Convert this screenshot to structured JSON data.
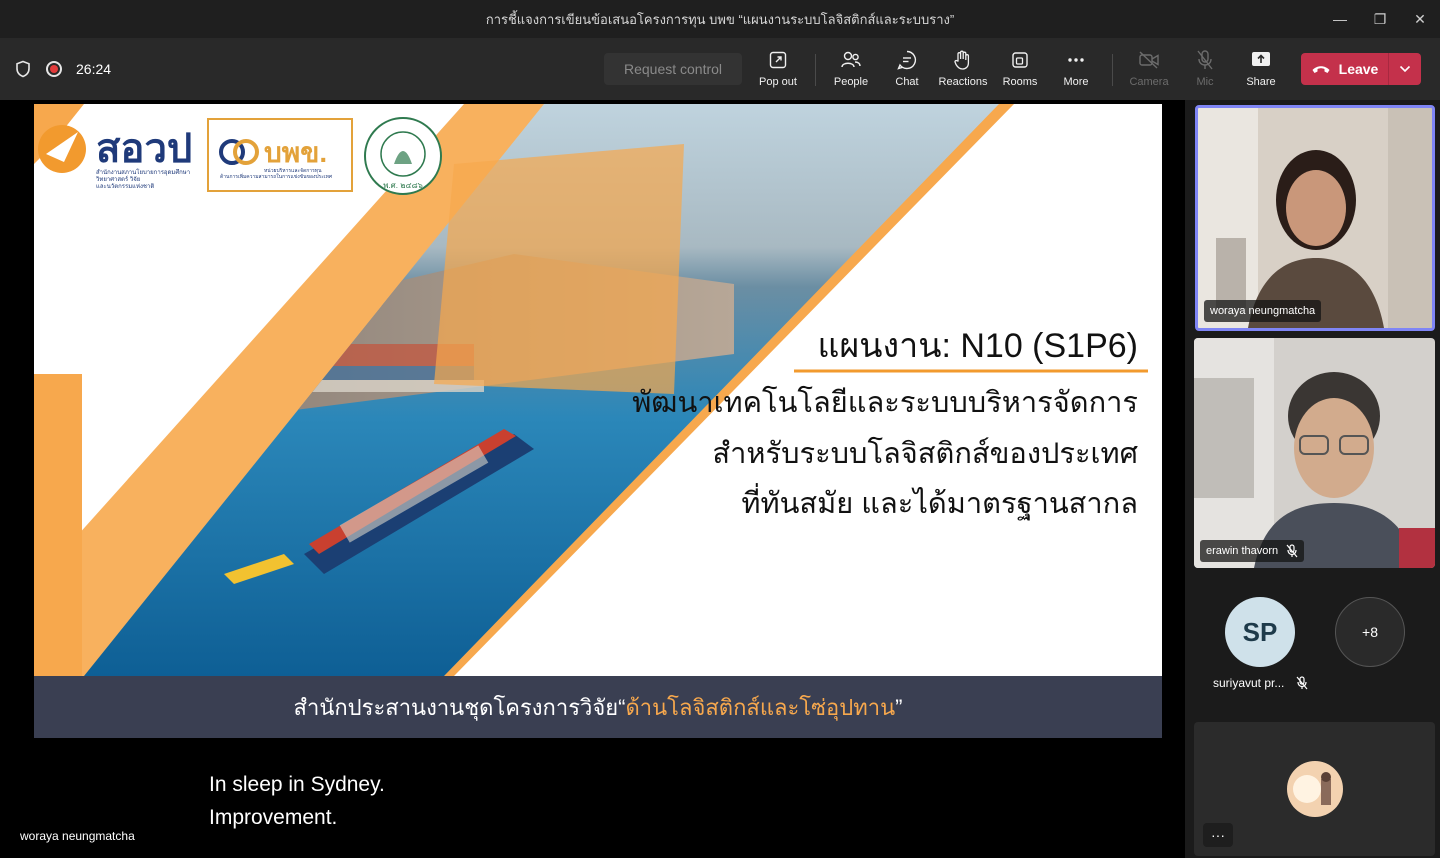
{
  "window": {
    "title": "การชี้แจงการเขียนข้อเสนอโครงการทุน บพข “แผนงานระบบโลจิสติกส์และระบบราง”",
    "minimize": "—",
    "restore": "❐",
    "close": "✕"
  },
  "toolbar": {
    "timer": "26:24",
    "request_control": "Request control",
    "pop_out": "Pop out",
    "people": "People",
    "chat": "Chat",
    "reactions": "Reactions",
    "rooms": "Rooms",
    "more": "More",
    "camera": "Camera",
    "mic": "Mic",
    "share": "Share",
    "leave": "Leave"
  },
  "slide": {
    "logo1_text": "สอวป",
    "logo1_sub1": "สำนักงานสภานโยบายการอุดมศึกษา",
    "logo1_sub2": "วิทยาศาสตร์ วิจัย",
    "logo1_sub3": "และนวัตกรรมแห่งชาติ",
    "logo2_text": "บพข.",
    "logo2_sub1": "หน่วยบริหารและจัดการทุน",
    "logo2_sub2": "ด้านการเพิ่มความสามารถในการแข่งขันของประเทศ",
    "seal_year": "พ.ศ. ๒๔๘๖",
    "title": "แผนงาน: N10 (S1P6)",
    "line1": "พัฒนาเทคโนโลยีและระบบบริหารจัดการ",
    "line2": "สำหรับระบบโลจิสติกส์ของประเทศ",
    "line3": "ที่ทันสมัย และได้มาตรฐานสากล",
    "footer_prefix": "สำนักประสานงานชุดโครงการวิจัย“",
    "footer_highlight": "ด้านโลจิสติกส์และโซ่อุปทาน",
    "footer_suffix": "”"
  },
  "captions": {
    "line1": "In sleep in Sydney.",
    "line2": "Improvement."
  },
  "stage_presenter": "woraya neungmatcha",
  "participants": {
    "tile1_name": "woraya neungmatcha",
    "tile2_name": "erawin thavorn",
    "sp_initials": "SP",
    "sp_name": "suriyavut pr...",
    "more_count": "+8",
    "self_more": "···"
  },
  "colors": {
    "accent_orange": "#f7a84d",
    "leave_red": "#c4314b",
    "active_border": "#7f85f5",
    "footer_bg": "#3a3f52"
  }
}
